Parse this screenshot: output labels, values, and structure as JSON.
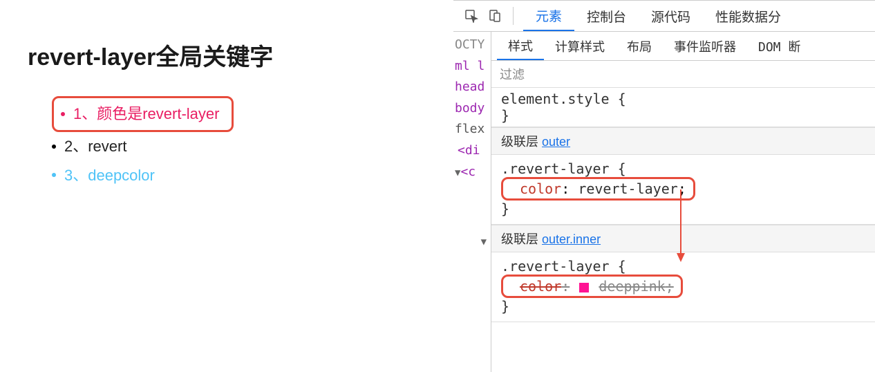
{
  "page": {
    "title": "revert-layer全局关键字",
    "items": [
      {
        "text": "1、颜色是revert-layer",
        "colorClass": "txt-pink",
        "bulletClass": "bullet-pink",
        "highlighted": true
      },
      {
        "text": "2、revert",
        "colorClass": "txt-black",
        "bulletClass": "bullet-black",
        "highlighted": false
      },
      {
        "text": "3、deepcolor",
        "colorClass": "txt-blue",
        "bulletClass": "bullet-blue",
        "highlighted": false
      }
    ]
  },
  "devtools": {
    "tabs": [
      "元素",
      "控制台",
      "源代码",
      "性能数据分"
    ],
    "active_tab": "元素",
    "subtabs": [
      "样式",
      "计算样式",
      "布局",
      "事件监听器",
      "DOM 断"
    ],
    "active_subtab": "样式",
    "filter_placeholder": "过滤",
    "dom_lines": [
      "OCTY",
      "ml l",
      "head",
      "body",
      "flex",
      "<di",
      "<c"
    ],
    "element_style": {
      "selector": "element.style",
      "open": "{",
      "close": "}"
    },
    "layer1": {
      "label": "级联层",
      "link": "outer",
      "selector": ".revert-layer",
      "open": "{",
      "prop": "color",
      "colon": ":",
      "val": "revert-layer",
      "semi": ";",
      "close": "}"
    },
    "layer2": {
      "label": "级联层",
      "link": "outer.inner",
      "selector": ".revert-layer",
      "open": "{",
      "prop": "color",
      "colon": ":",
      "val": "deeppink",
      "semi": ";",
      "close": "}"
    }
  }
}
